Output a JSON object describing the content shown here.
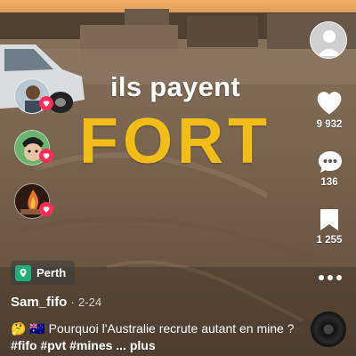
{
  "video": {
    "caption_line1": "ils payent",
    "caption_line2": "FORT"
  },
  "right_rail": {
    "like_count": "9 932",
    "comment_count": "136",
    "save_count": "1 255"
  },
  "location": {
    "label": "Perth"
  },
  "post": {
    "username": "Sam_fifo",
    "separator": "·",
    "date": "2-24",
    "emoji": "🤔 🇦🇺",
    "text": "Pourquoi l'Australie recrute autant en mine ?",
    "hashtags": [
      "#fifo",
      "#pvt",
      "#mines"
    ],
    "more_label": "... plus"
  },
  "icons": [
    "profile-avatar-icon",
    "heart-icon",
    "comment-icon",
    "bookmark-icon",
    "more-icon",
    "location-icon",
    "music-disc-icon"
  ],
  "colors": {
    "caption_accent": "#f2bd17",
    "like_badge": "#fe2c55",
    "location_icon_bg": "#1fb07a"
  }
}
